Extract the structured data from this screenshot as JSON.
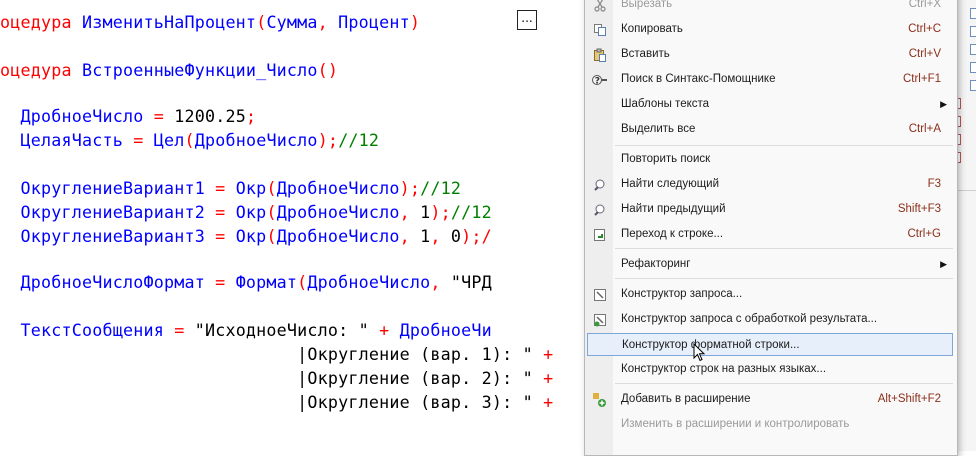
{
  "editor": {
    "lines": [
      {
        "segments": [
          {
            "t": "оцедура ",
            "c": "kw"
          },
          {
            "t": "ИзменитьНаПроцент",
            "c": "id"
          },
          {
            "t": "(",
            "c": "op"
          },
          {
            "t": "Сумма",
            "c": "id"
          },
          {
            "t": ", ",
            "c": "op"
          },
          {
            "t": "Процент",
            "c": "id"
          },
          {
            "t": ")",
            "c": "op"
          }
        ]
      },
      {
        "segments": [
          {
            "t": "оцедура ",
            "c": "kw"
          },
          {
            "t": "ВстроенныеФункции_Число",
            "c": "id"
          },
          {
            "t": "()",
            "c": "op"
          }
        ]
      },
      {
        "segments": [
          {
            "t": "  ДробноеЧисло",
            "c": "id"
          },
          {
            "t": " = ",
            "c": "op"
          },
          {
            "t": "1200.25",
            "c": "num"
          },
          {
            "t": ";",
            "c": "op"
          }
        ]
      },
      {
        "segments": [
          {
            "t": "  ЦелаяЧасть",
            "c": "id"
          },
          {
            "t": " = ",
            "c": "op"
          },
          {
            "t": "Цел",
            "c": "id"
          },
          {
            "t": "(",
            "c": "op"
          },
          {
            "t": "ДробноеЧисло",
            "c": "id"
          },
          {
            "t": ");",
            "c": "op"
          },
          {
            "t": "//12",
            "c": "cm"
          }
        ]
      },
      {
        "segments": [
          {
            "t": "  ОкруглениеВариант1",
            "c": "id"
          },
          {
            "t": " = ",
            "c": "op"
          },
          {
            "t": "Окр",
            "c": "id"
          },
          {
            "t": "(",
            "c": "op"
          },
          {
            "t": "ДробноеЧисло",
            "c": "id"
          },
          {
            "t": ");",
            "c": "op"
          },
          {
            "t": "//12",
            "c": "cm"
          }
        ]
      },
      {
        "segments": [
          {
            "t": "  ОкруглениеВариант2",
            "c": "id"
          },
          {
            "t": " = ",
            "c": "op"
          },
          {
            "t": "Окр",
            "c": "id"
          },
          {
            "t": "(",
            "c": "op"
          },
          {
            "t": "ДробноеЧисло",
            "c": "id"
          },
          {
            "t": ", ",
            "c": "op"
          },
          {
            "t": "1",
            "c": "num"
          },
          {
            "t": ");",
            "c": "op"
          },
          {
            "t": "//12",
            "c": "cm"
          }
        ]
      },
      {
        "segments": [
          {
            "t": "  ОкруглениеВариант3",
            "c": "id"
          },
          {
            "t": " = ",
            "c": "op"
          },
          {
            "t": "Окр",
            "c": "id"
          },
          {
            "t": "(",
            "c": "op"
          },
          {
            "t": "ДробноеЧисло",
            "c": "id"
          },
          {
            "t": ", ",
            "c": "op"
          },
          {
            "t": "1",
            "c": "num"
          },
          {
            "t": ", ",
            "c": "op"
          },
          {
            "t": "0",
            "c": "num"
          },
          {
            "t": ");/",
            "c": "op"
          }
        ]
      },
      {
        "segments": [
          {
            "t": "  ДробноеЧислоФормат",
            "c": "id"
          },
          {
            "t": " = ",
            "c": "op"
          },
          {
            "t": "Формат",
            "c": "id"
          },
          {
            "t": "(",
            "c": "op"
          },
          {
            "t": "ДробноеЧисло",
            "c": "id"
          },
          {
            "t": ", ",
            "c": "op"
          },
          {
            "t": "\"ЧРД",
            "c": "st"
          }
        ]
      },
      {
        "segments": [
          {
            "t": "  ТекстСообщения",
            "c": "id"
          },
          {
            "t": " = ",
            "c": "op"
          },
          {
            "t": "\"ИсходноеЧисло: \"",
            "c": "st"
          },
          {
            "t": " + ",
            "c": "op"
          },
          {
            "t": "ДробноеЧи",
            "c": "id"
          }
        ]
      },
      {
        "segments": [
          {
            "t": "                             |Округление (вар. 1): \"",
            "c": "st"
          },
          {
            "t": " + ",
            "c": "op"
          }
        ]
      },
      {
        "segments": [
          {
            "t": "                             |Округление (вар. 2): \"",
            "c": "st"
          },
          {
            "t": " + ",
            "c": "op"
          }
        ]
      },
      {
        "segments": [
          {
            "t": "                             |Округление (вар. 3): \"",
            "c": "st"
          },
          {
            "t": " + ",
            "c": "op"
          }
        ]
      }
    ],
    "dots_button": "..."
  },
  "menu": {
    "items": [
      {
        "label": "Вырезать",
        "shortcut": "Ctrl+X",
        "icon": "scissors-icon",
        "disabled": true
      },
      {
        "label": "Копировать",
        "shortcut": "Ctrl+C",
        "icon": "copy-icon"
      },
      {
        "label": "Вставить",
        "shortcut": "Ctrl+V",
        "icon": "paste-icon"
      },
      {
        "label": "Поиск в Синтакс-Помощнике",
        "shortcut": "Ctrl+F1",
        "icon": "syntax-help-icon"
      },
      {
        "label": "Шаблоны текста",
        "submenu": true
      },
      {
        "label": "Выделить все",
        "shortcut": "Ctrl+A"
      },
      {
        "label": "Повторить поиск"
      },
      {
        "label": "Найти следующий",
        "shortcut": "F3",
        "icon": "find-next-icon"
      },
      {
        "label": "Найти предыдущий",
        "shortcut": "Shift+F3",
        "icon": "find-prev-icon"
      },
      {
        "label": "Переход к строке...",
        "shortcut": "Ctrl+G",
        "icon": "goto-line-icon"
      },
      {
        "label": "Рефакторинг",
        "submenu": true
      },
      {
        "label": "Конструктор запроса...",
        "icon": "query-builder-icon"
      },
      {
        "label": "Конструктор запроса с обработкой результата...",
        "icon": "query-builder-result-icon"
      },
      {
        "label": "Конструктор форматной строки...",
        "highlighted": true
      },
      {
        "label": "Конструктор строк на разных языках..."
      },
      {
        "label": "Добавить в расширение",
        "shortcut": "Alt+Shift+F2",
        "icon": "add-extension-icon"
      },
      {
        "label": "Изменить в расширении и контролировать",
        "disabled": true
      }
    ]
  }
}
